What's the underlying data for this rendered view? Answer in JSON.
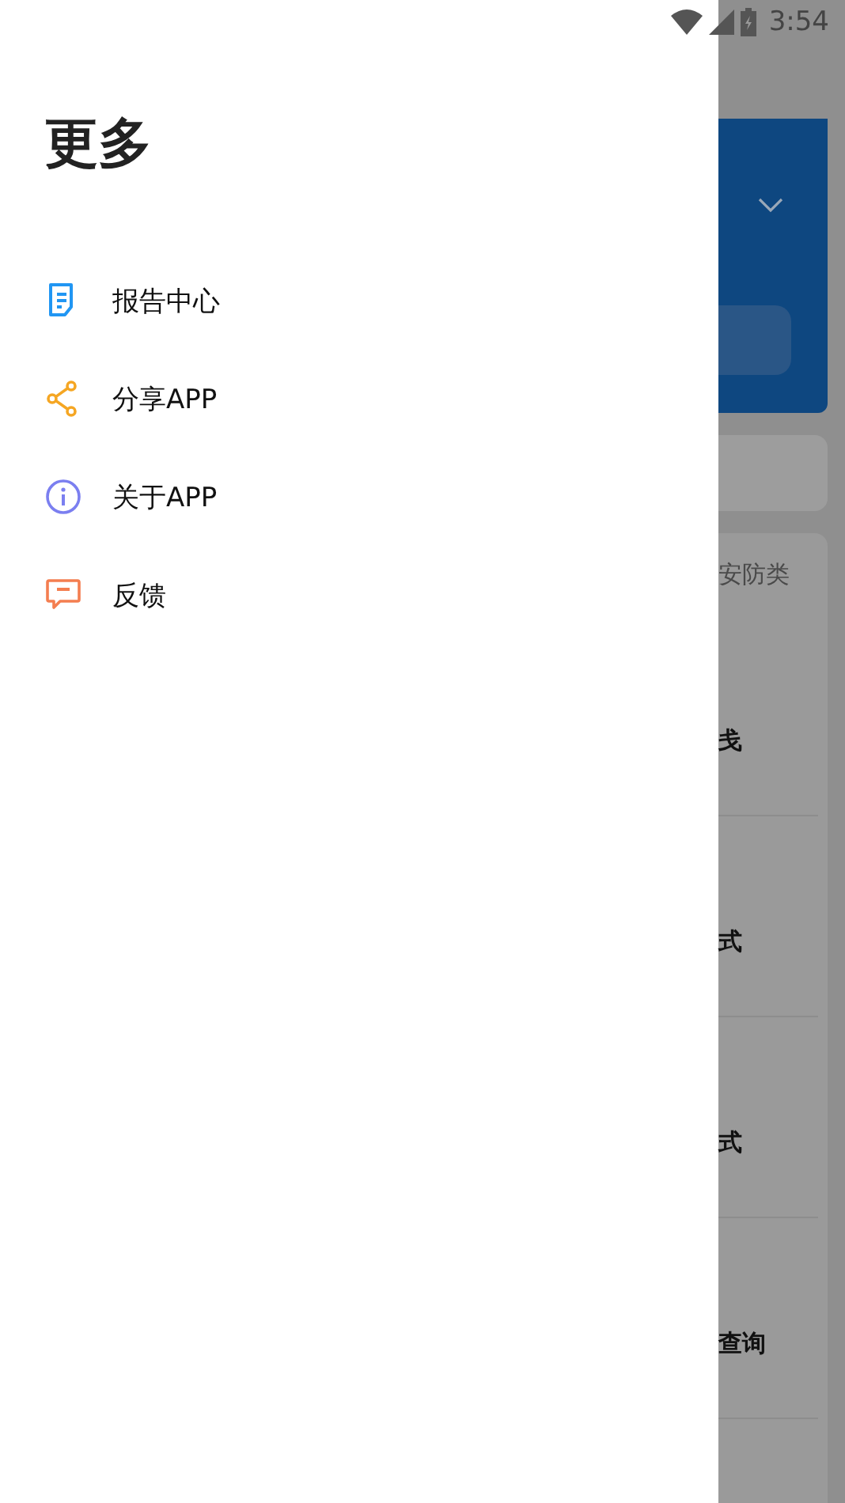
{
  "status_bar": {
    "time": "3:54"
  },
  "drawer": {
    "title": "更多",
    "items": [
      {
        "kind": "report",
        "label": "报告中心",
        "color": "#2196f3"
      },
      {
        "kind": "share",
        "label": "分享APP",
        "color": "#f5a623"
      },
      {
        "kind": "info",
        "label": "关于APP",
        "color": "#7b7ff0"
      },
      {
        "kind": "feedback",
        "label": "反馈",
        "color": "#f47e50"
      }
    ]
  },
  "background": {
    "tab": "安防类",
    "rows": [
      "戋",
      "式",
      "式",
      "查询"
    ]
  }
}
